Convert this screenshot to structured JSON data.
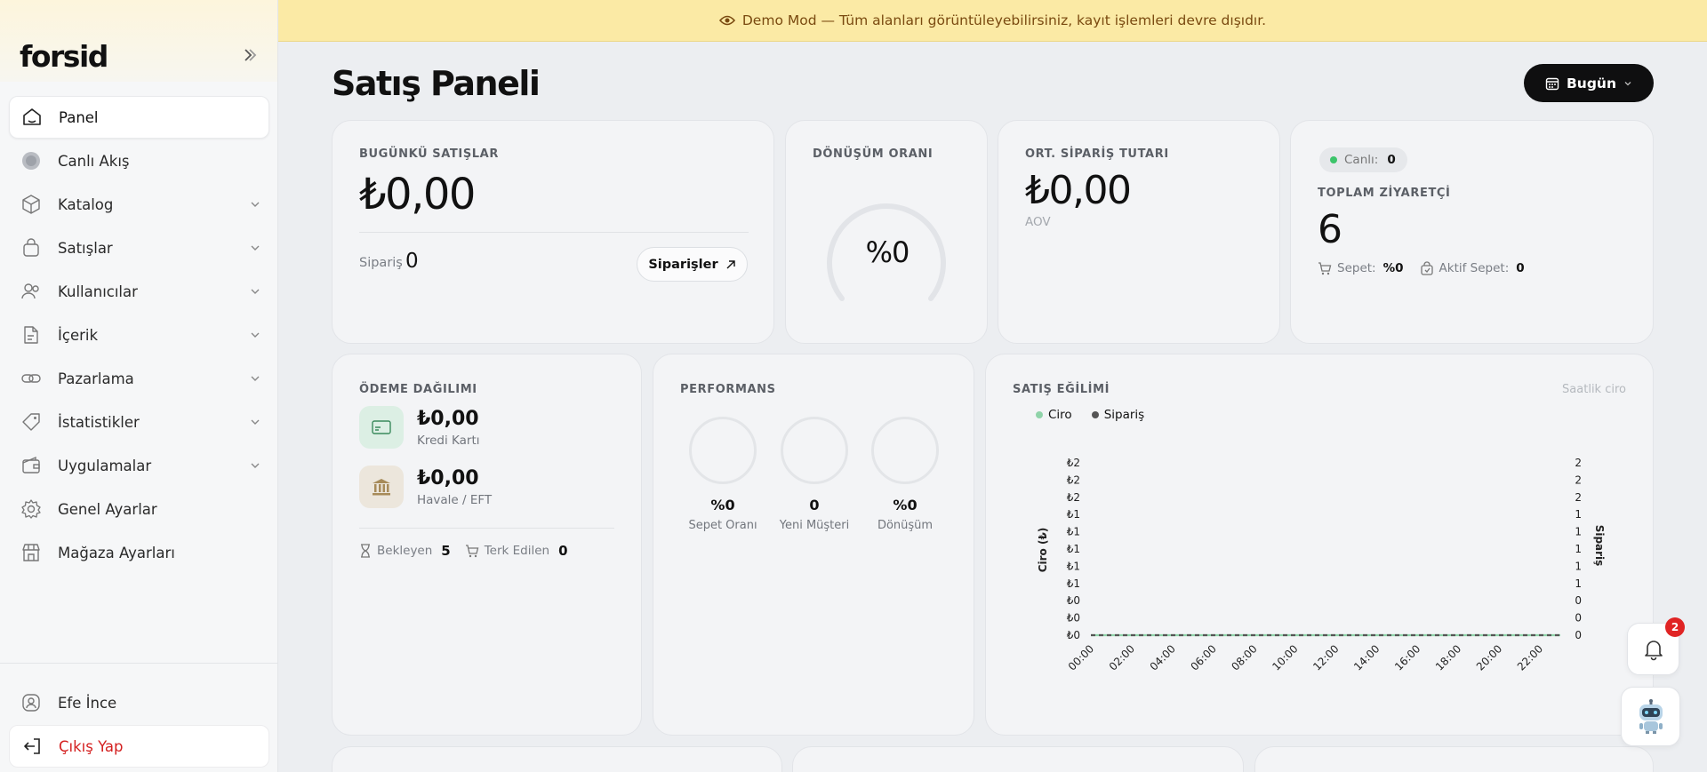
{
  "brand": {
    "logo": "forsid"
  },
  "banner": {
    "text": "Demo Mod — Tüm alanları görüntüleyebilirsiniz, kayıt işlemleri devre dışıdır."
  },
  "sidebar": {
    "items": [
      {
        "label": "Panel",
        "icon": "home-icon"
      },
      {
        "label": "Canlı Akış",
        "icon": "live-icon"
      },
      {
        "label": "Katalog",
        "icon": "box-icon"
      },
      {
        "label": "Satışlar",
        "icon": "bag-icon"
      },
      {
        "label": "Kullanıcılar",
        "icon": "users-icon"
      },
      {
        "label": "İçerik",
        "icon": "document-icon"
      },
      {
        "label": "Pazarlama",
        "icon": "link-icon"
      },
      {
        "label": "İstatistikler",
        "icon": "tag-icon"
      },
      {
        "label": "Uygulamalar",
        "icon": "wallet-icon"
      },
      {
        "label": "Genel Ayarlar",
        "icon": "gear-icon"
      },
      {
        "label": "Mağaza Ayarları",
        "icon": "store-icon"
      }
    ],
    "user": {
      "name": "Efe İnce"
    },
    "logout": {
      "label": "Çıkış Yap"
    }
  },
  "header": {
    "title": "Satış Paneli",
    "date_filter": "Bugün"
  },
  "today_sales": {
    "label": "BUGÜNKÜ SATIŞLAR",
    "value": "₺0,00",
    "orders_label": "Sipariş",
    "orders_value": "0",
    "orders_button": "Siparişler"
  },
  "conversion": {
    "label": "DÖNÜŞÜM ORANI",
    "value": "%0"
  },
  "aov": {
    "label": "ORT. SİPARİŞ TUTARI",
    "value": "₺0,00",
    "sub": "AOV"
  },
  "visitors": {
    "live_label": "Canlı:",
    "live_value": "0",
    "label": "TOPLAM ZİYARETÇİ",
    "value": "6",
    "cart_label": "Sepet:",
    "cart_value": "%0",
    "active_cart_label": "Aktif Sepet:",
    "active_cart_value": "0"
  },
  "payments": {
    "label": "ÖDEME DAĞILIMI",
    "methods": [
      {
        "amount": "₺0,00",
        "name": "Kredi Kartı"
      },
      {
        "amount": "₺0,00",
        "name": "Havale / EFT"
      }
    ],
    "pending_label": "Bekleyen",
    "pending_value": "5",
    "abandoned_label": "Terk Edilen",
    "abandoned_value": "0"
  },
  "performance": {
    "label": "PERFORMANS",
    "items": [
      {
        "value": "%0",
        "label": "Sepet Oranı"
      },
      {
        "value": "0",
        "label": "Yeni Müşteri"
      },
      {
        "value": "%0",
        "label": "Dönüşüm"
      }
    ]
  },
  "trend": {
    "label": "SATIŞ EĞİLİMİ",
    "note": "Saatlik ciro"
  },
  "notifications": {
    "count": "2"
  },
  "colors": {
    "accent": "#0f0f10",
    "danger": "#d42020",
    "live": "#3cc46a",
    "ciro": "#8fd3a9",
    "siparis": "#555555",
    "banner": "#fbeaa5"
  },
  "chart_data": {
    "type": "line",
    "title": "",
    "xlabel": "",
    "ylabel": "Ciro (₺)",
    "y2label": "Sipariş",
    "x": [
      "00:00",
      "01:00",
      "02:00",
      "03:00",
      "04:00",
      "05:00",
      "06:00",
      "07:00",
      "08:00",
      "09:00",
      "10:00",
      "11:00",
      "12:00",
      "13:00",
      "14:00",
      "15:00",
      "16:00",
      "17:00",
      "18:00",
      "19:00",
      "20:00",
      "21:00",
      "22:00",
      "23:00"
    ],
    "x_tick_labels": [
      "00:00",
      "02:00",
      "04:00",
      "06:00",
      "08:00",
      "10:00",
      "12:00",
      "14:00",
      "16:00",
      "18:00",
      "20:00",
      "22:00"
    ],
    "y_tick_labels": [
      "₺2",
      "₺2",
      "₺2",
      "₺1",
      "₺1",
      "₺1",
      "₺1",
      "₺1",
      "₺0",
      "₺0",
      "₺0"
    ],
    "y2_tick_labels": [
      "2",
      "2",
      "2",
      "1",
      "1",
      "1",
      "1",
      "1",
      "0",
      "0",
      "0"
    ],
    "series": [
      {
        "name": "Ciro",
        "values": [
          0,
          0,
          0,
          0,
          0,
          0,
          0,
          0,
          0,
          0,
          0,
          0,
          0,
          0,
          0,
          0,
          0,
          0,
          0,
          0,
          0,
          0,
          0,
          0
        ]
      },
      {
        "name": "Sipariş",
        "values": [
          0,
          0,
          0,
          0,
          0,
          0,
          0,
          0,
          0,
          0,
          0,
          0,
          0,
          0,
          0,
          0,
          0,
          0,
          0,
          0,
          0,
          0,
          0,
          0
        ]
      }
    ],
    "ylim": [
      0,
      2
    ],
    "legend": "top-left",
    "grid": false
  }
}
